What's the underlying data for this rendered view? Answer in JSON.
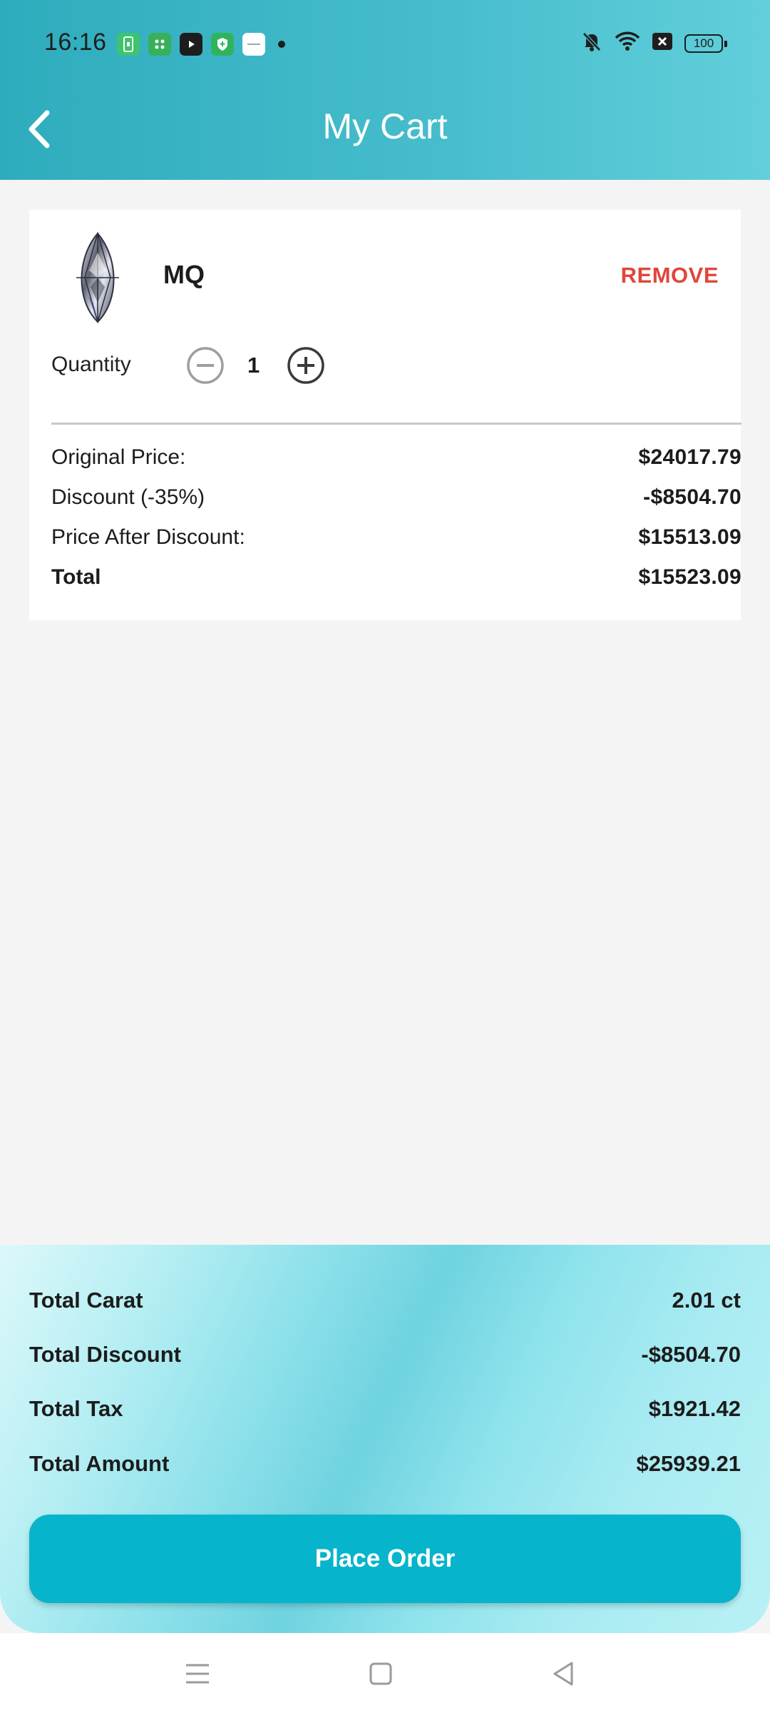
{
  "status_bar": {
    "time": "16:16",
    "battery": "100",
    "notification_icons": [
      "phone-app-icon",
      "grid-app-icon",
      "youtube-icon",
      "shield-app-icon",
      "white-app-icon"
    ],
    "system_icons": [
      "bell-muted-icon",
      "wifi-icon",
      "close-box-icon",
      "battery-icon"
    ]
  },
  "header": {
    "title": "My Cart",
    "back_icon": "chevron-left-icon",
    "background_color": "#45bccb"
  },
  "cart_item": {
    "image": "marquise-diamond-icon",
    "name": "MQ",
    "remove_label": "REMOVE",
    "remove_color": "#e0463b",
    "quantity_label": "Quantity",
    "quantity": "1",
    "prices": [
      {
        "label": "Original Price:",
        "value": "$24017.79"
      },
      {
        "label": "Discount (-35%)",
        "value": "-$8504.70"
      },
      {
        "label": "Price After Discount:",
        "value": "$15513.09"
      },
      {
        "label": "Total",
        "value": "$15523.09"
      }
    ]
  },
  "summary": {
    "rows": [
      {
        "label": "Total Carat",
        "value": "2.01 ct"
      },
      {
        "label": "Total Discount",
        "value": "-$8504.70"
      },
      {
        "label": "Total Tax",
        "value": "$1921.42"
      },
      {
        "label": "Total Amount",
        "value": "$25939.21"
      }
    ],
    "place_order_label": "Place Order",
    "button_color": "#06b4cc"
  },
  "nav_bar": {
    "icons": [
      "menu-icon",
      "home-square-icon",
      "back-triangle-icon"
    ]
  }
}
